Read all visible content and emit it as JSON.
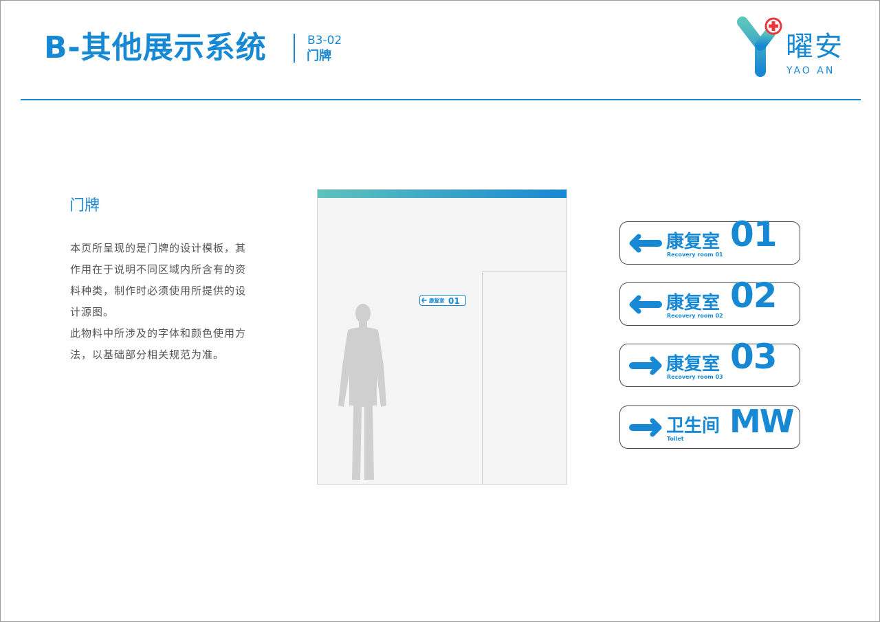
{
  "header": {
    "title": "B-其他展示系统",
    "code": "B3-02",
    "code_label": "门牌"
  },
  "logo": {
    "name": "曜安",
    "name_en": "YAO AN",
    "icon": "y-letter-with-medical-cross-icon"
  },
  "section": {
    "title": "门牌",
    "paragraphs": [
      "本页所呈现的是门牌的设计模板，其作用在于说明不同区域内所含有的资料种类，制作时必须使用所提供的设计源图。",
      "此物料中所涉及的字体和颜色使用方法，以基础部分相关规范为准。"
    ]
  },
  "scene": {
    "sign": {
      "name": "康复室",
      "number": "01"
    },
    "figure_icon": "standing-man-silhouette-icon"
  },
  "signs": [
    {
      "direction": "left",
      "arrow_icon": "arrow-left-icon",
      "name": "康复室",
      "name_en": "Recovery room 01",
      "number": "01"
    },
    {
      "direction": "left",
      "arrow_icon": "arrow-left-icon",
      "name": "康复室",
      "name_en": "Recovery room 02",
      "number": "02"
    },
    {
      "direction": "right",
      "arrow_icon": "arrow-right-icon",
      "name": "康复室",
      "name_en": "Recovery room 03",
      "number": "03"
    },
    {
      "direction": "right",
      "arrow_icon": "arrow-right-icon",
      "name": "卫生间",
      "name_en": "Toilet",
      "number": "MW"
    }
  ],
  "colors": {
    "brand_blue": "#1788d4",
    "brand_teal": "#5cc4bb",
    "logo_cross": "#e8383d",
    "text_gray": "#555555"
  }
}
